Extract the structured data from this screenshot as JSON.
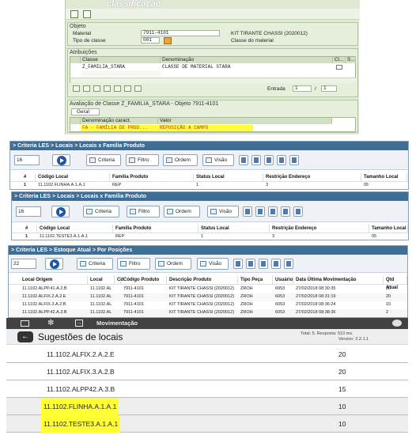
{
  "sap": {
    "title": "classificação",
    "objeto": {
      "header": "Objeto",
      "material_label": "Material",
      "material_value": "7911-4101",
      "material_desc": "KIT TIRANTE CHASSI (2020012)",
      "tipo_label": "Tipo de classe",
      "tipo_value": "001",
      "tipo_desc": "Classe do material"
    },
    "atribuicoes": {
      "header": "Atribuições",
      "columns": [
        "Classe",
        "Denominação",
        "Cl...",
        "S..."
      ],
      "rows": [
        [
          "Z_FAMILIA_STARA",
          "CLASSE DE MATERIAL STARA"
        ]
      ],
      "entrada_label": "Entrada",
      "entrada_value": "1",
      "entrada_of": "/",
      "entrada_total": "1"
    },
    "avaliacao": {
      "header": "Avaliação de Classe Z_FAMILIA_STARA - Objeto 7911-4101",
      "tab": "Geral",
      "columns": [
        "Denominação caract.",
        "Valor"
      ],
      "rows": [
        [
          "FA - FAMÍLIA DE PROD...",
          "REPOSIÇÃO A CAMPO"
        ]
      ]
    }
  },
  "panel1": {
    "breadcrumb": "> Criteria LES > Locais > Locais x Familia Produto",
    "spin_value": "16",
    "buttons": [
      "Criteria",
      "Filtro",
      "Ordem",
      "Visão"
    ],
    "columns": [
      "#",
      "Código Local",
      "Familia Produto",
      "Status Local",
      "Restrição Endereço",
      "Tamanho Local"
    ],
    "rows": [
      [
        "1",
        "11.1102.FLINHA.A.1.A.1",
        "REP",
        "1",
        "3",
        "05"
      ]
    ]
  },
  "panel2": {
    "breadcrumb": "> Criteria LES > Locais > Locais x Familia Produto",
    "spin_value": "16",
    "buttons": [
      "Criteria",
      "Filtro",
      "Ordem",
      "Visão"
    ],
    "columns": [
      "#",
      "Código Local",
      "Familia Produto",
      "Status Local",
      "Restrição Endereço",
      "Tamanho Local"
    ],
    "rows": [
      [
        "1",
        "11.1102.TESTE3.A.1.A.1",
        "REP",
        "1",
        "3",
        "05"
      ]
    ]
  },
  "panel3": {
    "breadcrumb": "> Criteria LES > Estoque Atual > Por Posições",
    "spin_value": "22",
    "buttons": [
      "Criteria",
      "Filtro",
      "Ordem",
      "Visão"
    ],
    "columns": [
      "Local Origem",
      "Local",
      "Cd",
      "Código Produto",
      "Descrição Produto",
      "Tipo Peça",
      "Usuário",
      "Data Última Movimentação",
      "Qtd Atual"
    ],
    "rows": [
      [
        "11.1102.ALPP.41.A.2.B",
        "11.1102.AL",
        "",
        "7911-4101",
        "KIT TIRANTE CHASSI (2020012)",
        "ZROH",
        "6053",
        "27/02/2018 08:30:35",
        "30"
      ],
      [
        "11.1102.ALFIX.2.A.2.E",
        "11.1102.AL",
        "",
        "7911-4101",
        "KIT TIRANTE CHASSI (2020012)",
        "ZROH",
        "6053",
        "27/02/2018 08:31:19",
        "20"
      ],
      [
        "11.1102.ALFIX.3.A.2.B",
        "11.1102.AL",
        "",
        "7911-4101",
        "KIT TIRANTE CHASSI (2020012)",
        "ZROH",
        "6053",
        "27/02/2018 08:36:24",
        "10"
      ],
      [
        "11.1102.ALPP.42.A.3.B",
        "11.1102.AL",
        "",
        "7911-4101",
        "KIT TIRANTE CHASSI (2020012)",
        "ZROH",
        "6053",
        "27/02/2018 08:38:36",
        "2"
      ]
    ]
  },
  "mobile": {
    "app_title": "Movimentação",
    "screen_title": "Sugestões de locais",
    "total_info": "Total: 5. Resposta: 510 ms.",
    "version": "Version: 2.2.1.1",
    "rows": [
      {
        "local": "11.1102.ALFIX.2.A.2.E",
        "qtd": "20"
      },
      {
        "local": "11.1102.ALFIX.3.A.2.B",
        "qtd": "20"
      },
      {
        "local": "11.1102.ALPP42.A.3.B",
        "qtd": "15"
      },
      {
        "local": "11.1102.FLINHA.A.1.A.1",
        "qtd": "10"
      },
      {
        "local": "11.1102.TESTE3.A.1.A.1",
        "qtd": "10"
      }
    ]
  },
  "colors": {
    "sap_bg": "#dfe9d3",
    "les_header": "#3e6d96",
    "highlight": "#ffff33",
    "mobile_bar": "#424242"
  }
}
